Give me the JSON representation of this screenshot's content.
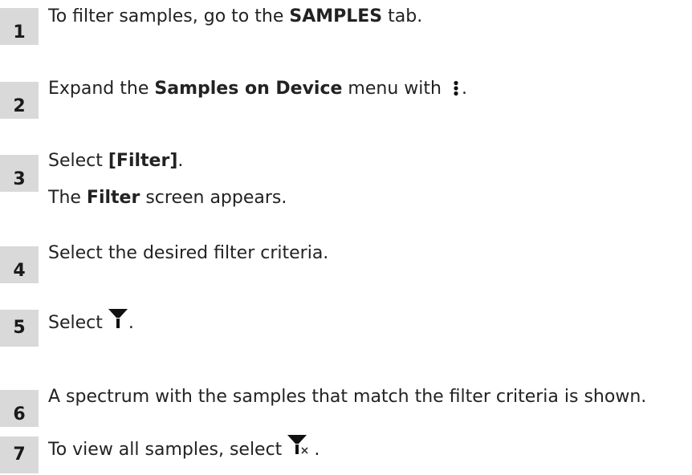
{
  "steps": [
    {
      "number": "1",
      "pre": "To filter samples, go to the ",
      "bold": "SAMPLES",
      "post": " tab."
    },
    {
      "number": "2",
      "pre": "Expand the ",
      "bold": "Samples on Device",
      "post": " menu with ",
      "icon": "more-vertical-icon",
      "after_icon": "."
    },
    {
      "number": "3",
      "pre": "Select ",
      "bold": "[Filter]",
      "post": ".",
      "result_pre": "The ",
      "result_bold": "Filter",
      "result_post": " screen appears."
    },
    {
      "number": "4",
      "text": "Select the desired filter criteria."
    },
    {
      "number": "5",
      "pre": "Select ",
      "icon": "filter-icon",
      "after_icon": "."
    },
    {
      "number": "6",
      "text": "A spectrum with the samples that match the filter criteria is shown."
    },
    {
      "number": "7",
      "pre": "To view all samples, select ",
      "icon": "filter-clear-icon",
      "after_icon": "."
    }
  ]
}
